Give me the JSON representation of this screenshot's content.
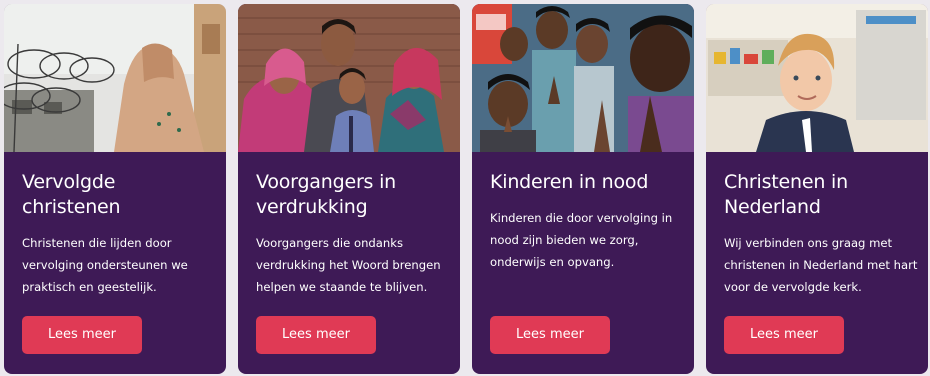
{
  "cards": [
    {
      "photo": "woman-in-headscarf-near-barbed-wire",
      "title": "Vervolgde christenen",
      "description": "Christenen die lijden door vervolging ondersteunen we praktisch en geestelijk.",
      "button_label": "Lees meer"
    },
    {
      "photo": "pastor-family-portrait",
      "title": "Voorgangers in verdrukking",
      "description": "Voorgangers die ondanks verdrukking het Woord brengen helpen we staande te blijven.",
      "button_label": "Lees meer"
    },
    {
      "photo": "praying-children",
      "title": "Kinderen in nood",
      "description": "Kinderen die door vervolging in nood zijn bieden we zorg, onderwijs en opvang.",
      "button_label": "Lees meer"
    },
    {
      "photo": "smiling-boy-in-classroom",
      "title": "Christenen in Nederland",
      "description": "Wij verbinden ons graag met christenen in Nederland met hart voor de vervolgde kerk.",
      "button_label": "Lees meer"
    }
  ],
  "colors": {
    "card_background": "#3e1a56",
    "button_background": "#e03a55",
    "page_background": "#ece9ee"
  }
}
